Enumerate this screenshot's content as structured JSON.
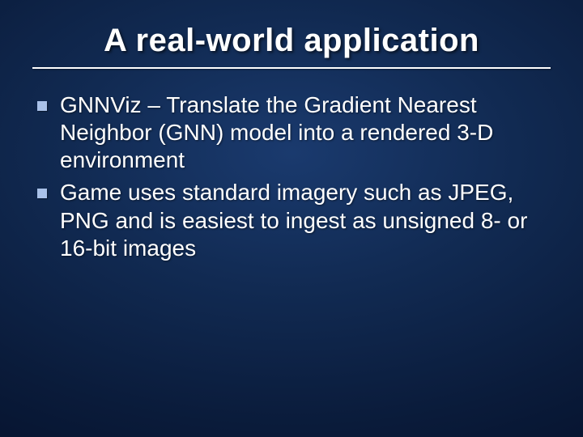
{
  "title": "A real-world application",
  "bullets": [
    "GNNViz – Translate the Gradient Nearest Neighbor (GNN) model into a rendered 3-D environment",
    "Game uses standard imagery such as JPEG, PNG and is easiest to ingest as unsigned 8- or 16-bit images"
  ]
}
